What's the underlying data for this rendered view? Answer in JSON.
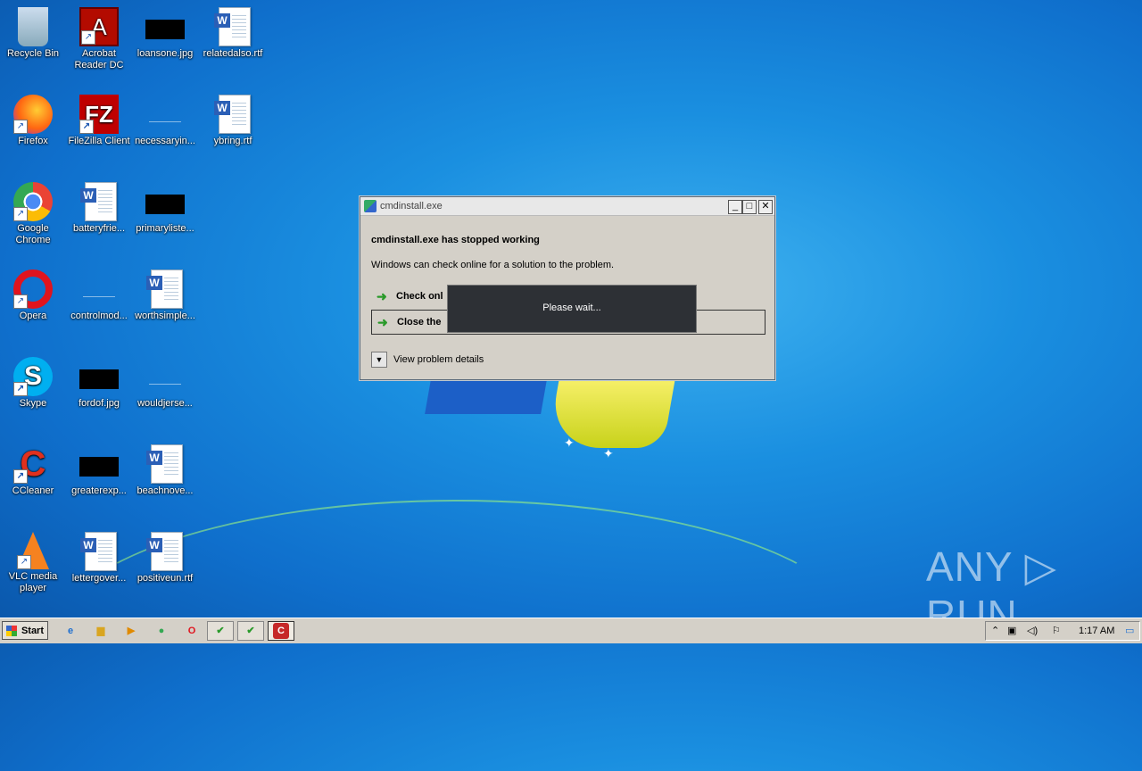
{
  "desktop": {
    "icons": [
      {
        "label": "Recycle Bin",
        "icon": "recycle-bin-icon"
      },
      {
        "label": "Acrobat Reader DC",
        "icon": "acrobat-icon"
      },
      {
        "label": "loansone.jpg",
        "icon": "image-file-icon"
      },
      {
        "label": "relatedalso.rtf",
        "icon": "word-doc-icon"
      },
      {
        "label": "Firefox",
        "icon": "firefox-icon"
      },
      {
        "label": "FileZilla Client",
        "icon": "filezilla-icon"
      },
      {
        "label": "necessaryin...",
        "icon": "blank-file-icon"
      },
      {
        "label": "ybring.rtf",
        "icon": "word-doc-icon"
      },
      {
        "label": "Google Chrome",
        "icon": "chrome-icon"
      },
      {
        "label": "batteryfrie...",
        "icon": "word-doc-icon"
      },
      {
        "label": "primaryliste...",
        "icon": "image-file-icon"
      },
      {
        "label": "Opera",
        "icon": "opera-icon"
      },
      {
        "label": "controlmod...",
        "icon": "blank-file-icon"
      },
      {
        "label": "worthsimple...",
        "icon": "word-doc-icon"
      },
      {
        "label": "Skype",
        "icon": "skype-icon"
      },
      {
        "label": "fordof.jpg",
        "icon": "image-file-icon"
      },
      {
        "label": "wouldjerse...",
        "icon": "blank-file-icon"
      },
      {
        "label": "CCleaner",
        "icon": "ccleaner-icon"
      },
      {
        "label": "greaterexp...",
        "icon": "image-file-icon"
      },
      {
        "label": "beachnove...",
        "icon": "word-doc-icon"
      },
      {
        "label": "VLC media player",
        "icon": "vlc-icon"
      },
      {
        "label": "lettergover...",
        "icon": "word-doc-icon"
      },
      {
        "label": "positiveun.rtf",
        "icon": "word-doc-icon"
      }
    ]
  },
  "dialog": {
    "title": "cmdinstall.exe",
    "heading": "cmdinstall.exe has stopped working",
    "message": "Windows can check online for a solution to the problem.",
    "option1": "Check onl",
    "option2": "Close the",
    "details": "View problem details",
    "wait": "Please wait...",
    "min_glyph": "_",
    "max_glyph": "□",
    "close_glyph": "✕"
  },
  "taskbar": {
    "start": "Start",
    "clock": "1:17 AM"
  },
  "watermark": "ANY ▷ RUN",
  "glyphs": {
    "shortcut": "↗",
    "arrow": "➜",
    "dropdown": "▼",
    "tray_up": "⌃",
    "tray_network": "▣",
    "tray_volume": "◁)",
    "tray_flag": "⚐",
    "tray_desktop": "▭",
    "word": "W",
    "pdf": "A",
    "ccleaner": "C",
    "sparkle": "✦",
    "tb_ie": "e",
    "tb_folder": "▆",
    "tb_media": "▶",
    "tb_chrome": "●",
    "tb_opera": "O",
    "tb_task1": "✔",
    "tb_task2": "✔",
    "tb_task3": "C"
  },
  "colors": {
    "wallpaper": "#1a8fe0",
    "dialog_bg": "#d4d0c8",
    "wait_bg": "#2d3035"
  }
}
